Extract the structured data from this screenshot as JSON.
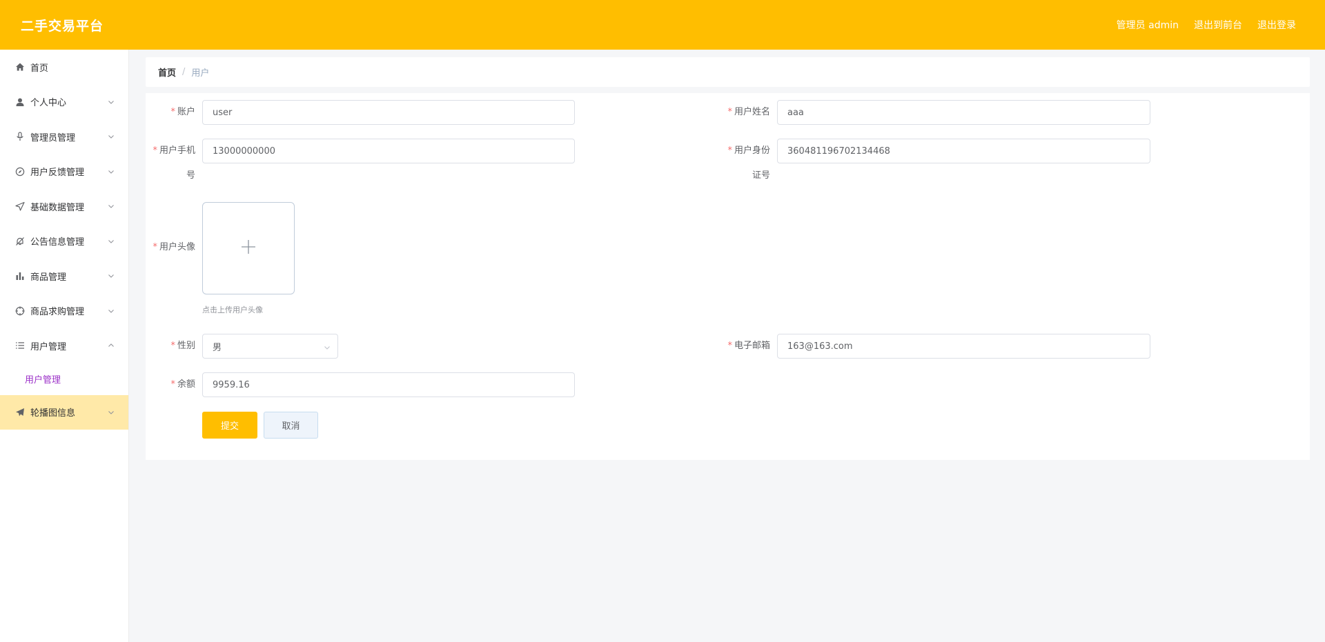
{
  "header": {
    "title": "二手交易平台",
    "admin_label": "管理员 admin",
    "front_link": "退出到前台",
    "logout_link": "退出登录"
  },
  "sidebar": {
    "items": [
      {
        "label": "首页",
        "icon": "home-icon"
      },
      {
        "label": "个人中心",
        "icon": "user-icon"
      },
      {
        "label": "管理员管理",
        "icon": "microphone-icon"
      },
      {
        "label": "用户反馈管理",
        "icon": "compass-icon"
      },
      {
        "label": "基础数据管理",
        "icon": "send-icon"
      },
      {
        "label": "公告信息管理",
        "icon": "bell-off-icon"
      },
      {
        "label": "商品管理",
        "icon": "bar-chart-icon"
      },
      {
        "label": "商品求购管理",
        "icon": "crosshair-icon"
      },
      {
        "label": "用户管理",
        "icon": "list-icon"
      },
      {
        "label": "轮播图信息",
        "icon": "paper-plane-icon"
      }
    ],
    "sub_item": "用户管理"
  },
  "breadcrumb": {
    "home": "首页",
    "separator": "/",
    "current": "用户"
  },
  "form": {
    "required_mark": "*",
    "account_label": "账户",
    "account_value": "user",
    "name_label": "用户姓名",
    "name_value": "aaa",
    "phone_label_line1": "用户手机",
    "phone_label_line2": "号",
    "phone_value": "13000000000",
    "idcard_label_line1": "用户身份",
    "idcard_label_line2": "证号",
    "idcard_value": "360481196702134468",
    "avatar_label": "用户头像",
    "avatar_tip": "点击上传用户头像",
    "gender_label": "性别",
    "gender_value": "男",
    "email_label": "电子邮箱",
    "email_value": "163@163.com",
    "balance_label": "余额",
    "balance_value": "9959.16",
    "submit_label": "提交",
    "cancel_label": "取消"
  },
  "colors": {
    "accent": "#ffbe00",
    "active_submenu": "#9b30c8",
    "highlight_row": "#ffe9a8",
    "required": "#f56c6c"
  }
}
